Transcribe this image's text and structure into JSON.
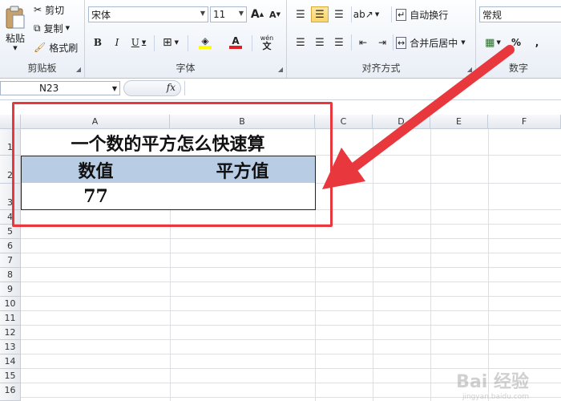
{
  "clipboard": {
    "paste": "粘贴",
    "cut": "剪切",
    "copy": "复制",
    "format_painter": "格式刷",
    "label": "剪贴板"
  },
  "font": {
    "name": "宋体",
    "size": "11",
    "grow": "A",
    "shrink": "A",
    "bold": "B",
    "italic": "I",
    "underline": "U",
    "label": "字体",
    "font_color_glyph": "A",
    "phonetic": "wén"
  },
  "alignment": {
    "wrap_text": "自动换行",
    "merge_center": "合并后居中",
    "label": "对齐方式"
  },
  "number": {
    "format": "常规",
    "percent": "%",
    "comma": ",",
    "label": "数字"
  },
  "formula_bar": {
    "name_box": "N23",
    "fx": "fx",
    "value": ""
  },
  "columns": [
    "A",
    "B",
    "C",
    "D",
    "E",
    "F"
  ],
  "rows": [
    "1",
    "2",
    "3",
    "4",
    "5",
    "6",
    "7",
    "8",
    "9",
    "10",
    "11",
    "12",
    "13",
    "14",
    "15",
    "16"
  ],
  "cells": {
    "title": "一个数的平方怎么快速算",
    "header_value": "数值",
    "header_square": "平方值",
    "value": "77",
    "square": ""
  },
  "colors": {
    "header_fill": "#b8cce4",
    "highlight": "#e8383d"
  },
  "watermark": {
    "text": "Bai 经验",
    "sub": "jingyan.baidu.com"
  }
}
